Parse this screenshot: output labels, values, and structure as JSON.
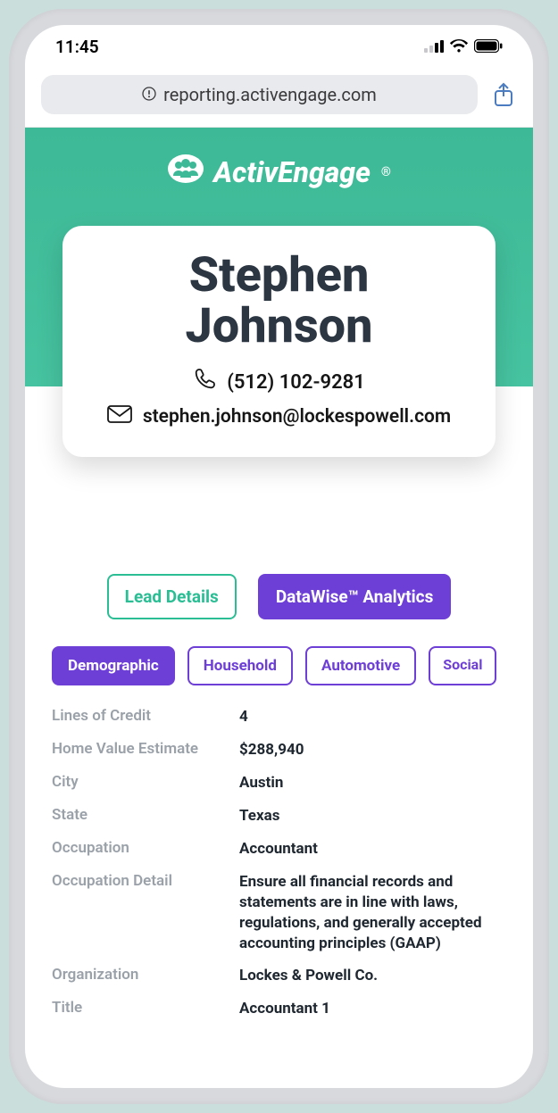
{
  "status": {
    "time": "11:45"
  },
  "browser": {
    "url": "reporting.activengage.com"
  },
  "brand": {
    "name": "ActivEngage"
  },
  "lead": {
    "name_first": "Stephen",
    "name_last": "Johnson",
    "phone": "(512) 102-9281",
    "email": "stephen.johnson@lockespowell.com"
  },
  "main_tabs": {
    "lead_details": "Lead Details",
    "datawise": "DataWise™ Analytics"
  },
  "sub_tabs": {
    "demographic": "Demographic",
    "household": "Household",
    "automotive": "Automotive",
    "social": "Social"
  },
  "fields": [
    {
      "label": "Lines of Credit",
      "value": "4"
    },
    {
      "label": "Home Value Estimate",
      "value": "$288,940"
    },
    {
      "label": "City",
      "value": "Austin"
    },
    {
      "label": "State",
      "value": "Texas"
    },
    {
      "label": "Occupation",
      "value": "Accountant"
    },
    {
      "label": "Occupation Detail",
      "value": "Ensure all financial records and statements are in line with laws, regulations, and generally accepted accounting principles (GAAP)"
    },
    {
      "label": "Organization",
      "value": "Lockes & Powell Co."
    },
    {
      "label": "Title",
      "value": "Accountant 1"
    }
  ]
}
